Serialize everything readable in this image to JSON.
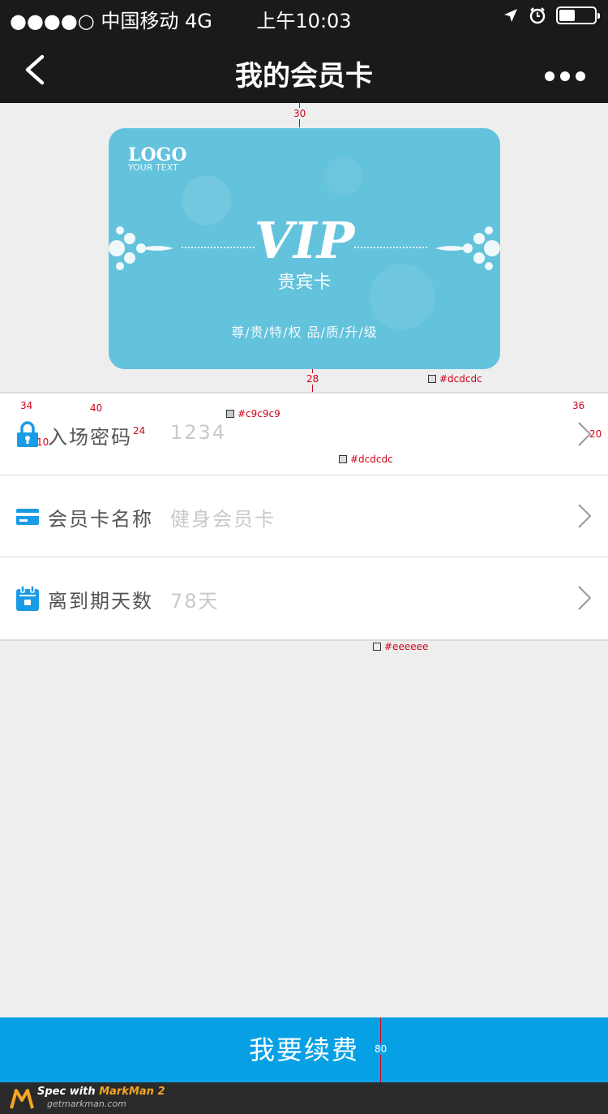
{
  "status_bar": {
    "carrier": "●●●●○ 中国移动   4G",
    "time": "上午10:03",
    "battery_level": 0.45
  },
  "nav": {
    "title": "我的会员卡"
  },
  "card": {
    "logo": "LOGO",
    "logo_sub": "YOUR TEXT",
    "vip": "VIP",
    "vip_sub": "贵宾卡",
    "slogan": "尊/贵/特/权   品/质/升/级"
  },
  "rows": [
    {
      "label": "入场密码",
      "value": "1234",
      "icon": "lock-icon"
    },
    {
      "label": "会员卡名称",
      "value": "健身会员卡",
      "icon": "credit-card-icon"
    },
    {
      "label": "离到期天数",
      "value": "78天",
      "icon": "calendar-icon"
    }
  ],
  "renew_button": "我要续费",
  "footer": {
    "spec_prefix": "Spec with ",
    "brand": "MarkMan 2",
    "url": "getmarkman.com"
  },
  "annotations": {
    "m30": "30",
    "m28": "28",
    "m34": "34",
    "m40": "40",
    "m10": "10",
    "m24": "24",
    "m36": "36",
    "m20": "20",
    "m80": "80",
    "c_card_border": "#dcdcdc",
    "c_value": "#c9c9c9",
    "c_row_border": "#dcdcdc",
    "c_bg": "#eeeeee"
  }
}
